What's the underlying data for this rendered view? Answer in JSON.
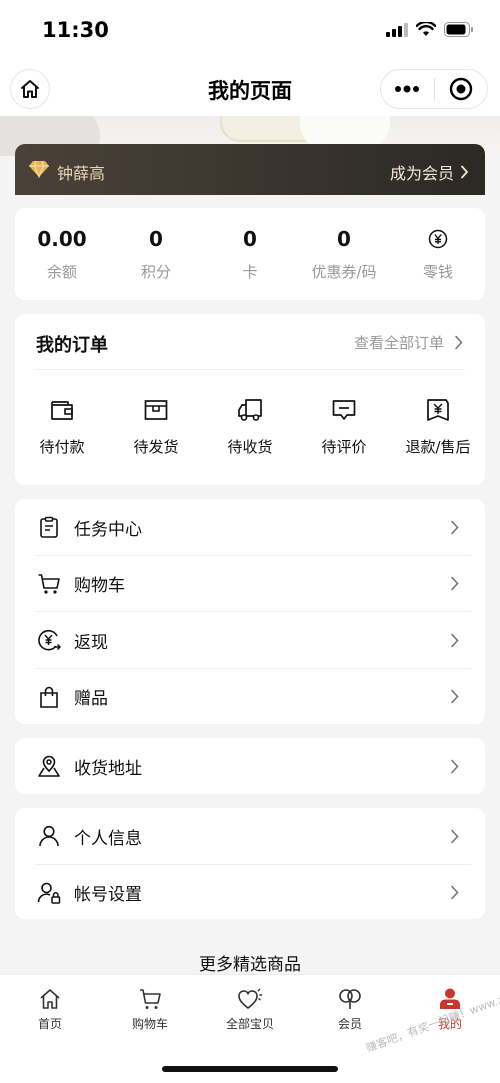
{
  "status_bar": {
    "time": "11:30"
  },
  "nav": {
    "title": "我的页面"
  },
  "vip": {
    "name": "钟薛高",
    "join_label": "成为会员"
  },
  "stats": [
    {
      "value": "0.00",
      "label": "余额"
    },
    {
      "value": "0",
      "label": "积分"
    },
    {
      "value": "0",
      "label": "卡"
    },
    {
      "value": "0",
      "label": "优惠券/码"
    },
    {
      "value": "",
      "label": "零钱",
      "icon": "yen-coin-icon"
    }
  ],
  "orders": {
    "title": "我的订单",
    "view_all": "查看全部订单",
    "items": [
      {
        "label": "待付款",
        "icon": "wallet-icon"
      },
      {
        "label": "待发货",
        "icon": "package-icon"
      },
      {
        "label": "待收货",
        "icon": "truck-icon"
      },
      {
        "label": "待评价",
        "icon": "comment-icon"
      },
      {
        "label": "退款/售后",
        "icon": "refund-icon"
      }
    ]
  },
  "menu_group1": [
    {
      "label": "任务中心",
      "icon": "clipboard-icon"
    },
    {
      "label": "购物车",
      "icon": "cart-icon"
    },
    {
      "label": "返现",
      "icon": "cashback-icon"
    },
    {
      "label": "赠品",
      "icon": "gift-bag-icon"
    }
  ],
  "menu_group2": [
    {
      "label": "收货地址",
      "icon": "map-pin-icon"
    }
  ],
  "menu_group3": [
    {
      "label": "个人信息",
      "icon": "person-icon"
    },
    {
      "label": "帐号设置",
      "icon": "account-lock-icon"
    }
  ],
  "more_title": "更多精选商品",
  "tabbar": {
    "active_index": 4,
    "active_color": "#c9372c",
    "items": [
      {
        "label": "首页",
        "icon": "home-icon"
      },
      {
        "label": "购物车",
        "icon": "cart-icon"
      },
      {
        "label": "全部宝贝",
        "icon": "heart-icon"
      },
      {
        "label": "会员",
        "icon": "member-icon"
      },
      {
        "label": "我的",
        "icon": "user-filled-icon"
      }
    ]
  },
  "watermark": "赚客吧，有奖一起赚！www.zuanke8.com"
}
